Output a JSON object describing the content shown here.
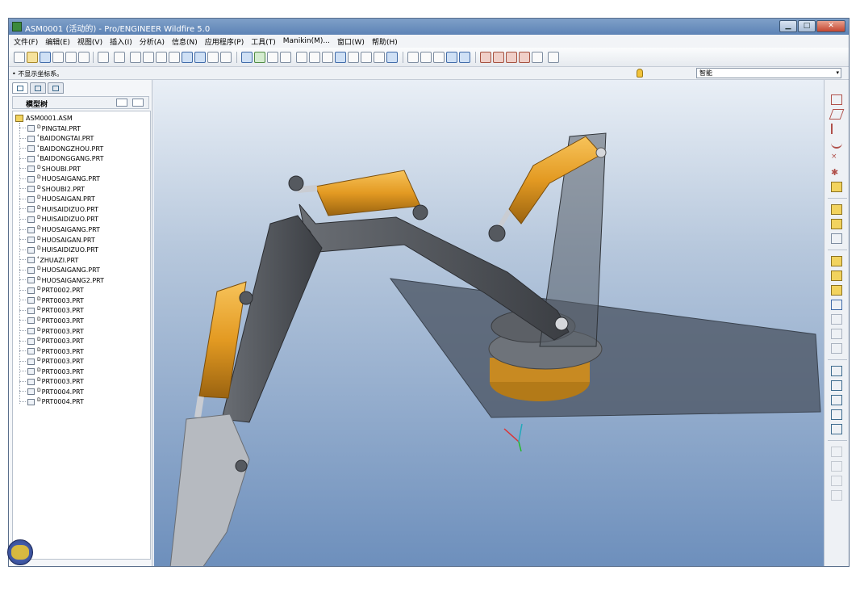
{
  "window": {
    "title": "ASM0001 (活动的) - Pro/ENGINEER Wildfire 5.0",
    "buttons": {
      "minimize": "▁",
      "maximize": "□",
      "close": "✕"
    }
  },
  "menu": [
    "文件(F)",
    "编辑(E)",
    "视图(V)",
    "插入(I)",
    "分析(A)",
    "信息(N)",
    "应用程序(P)",
    "工具(T)",
    "Manikin(M)...",
    "窗口(W)",
    "帮助(H)"
  ],
  "status": {
    "message": "• 不显示坐标系。",
    "filter_value": "智能"
  },
  "model_tree": {
    "title": "模型树",
    "root": "ASM0001.ASM",
    "items": [
      "PINGTAI.PRT",
      "BAIDONGTAI.PRT",
      "BAIDONGZHOU.PRT",
      "BAIDONGGANG.PRT",
      "SHOUBI.PRT",
      "HUOSAIGANG.PRT",
      "SHOUBI2.PRT",
      "HUOSAIGAN.PRT",
      "HUISAIDIZUO.PRT",
      "HUISAIDIZUO.PRT",
      "HUOSAIGANG.PRT",
      "HUOSAIGAN.PRT",
      "HUISAIDIZUO.PRT",
      "ZHUAZI.PRT",
      "HUOSAIGANG.PRT",
      "HUOSAIGANG2.PRT",
      "PRT0002.PRT",
      "PRT0003.PRT",
      "PRT0003.PRT",
      "PRT0003.PRT",
      "PRT0003.PRT",
      "PRT0003.PRT",
      "PRT0003.PRT",
      "PRT0003.PRT",
      "PRT0003.PRT",
      "PRT0003.PRT",
      "PRT0004.PRT",
      "PRT0004.PRT"
    ]
  },
  "colors": {
    "cylinder": "#e39a22",
    "arm": "#4b4e53",
    "platform": "#4d5866",
    "background_top": "#e9eff6",
    "background_bottom": "#6d8fbc"
  }
}
